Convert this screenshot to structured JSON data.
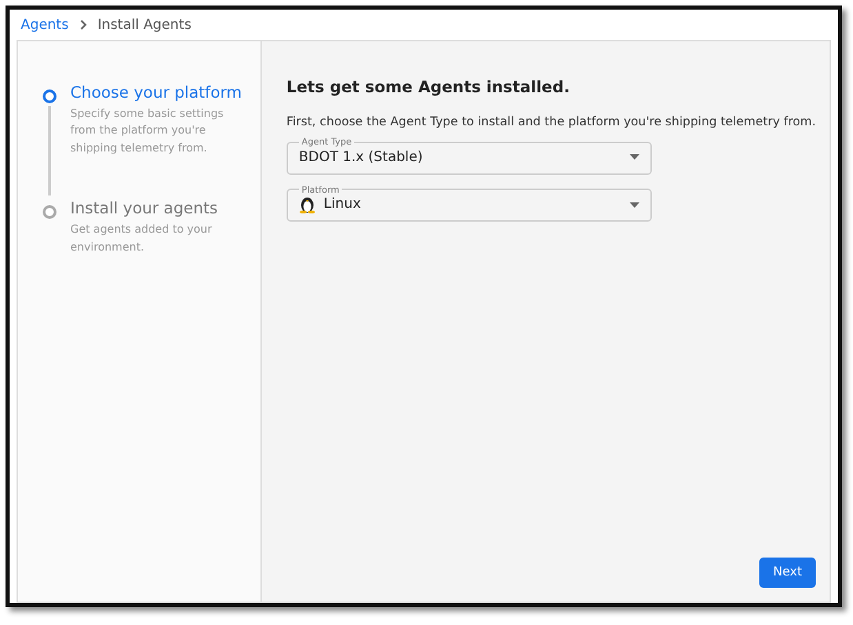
{
  "breadcrumb": [
    {
      "label": "Agents",
      "kind": "link"
    },
    {
      "label": "Install Agents",
      "kind": "current"
    }
  ],
  "steps": [
    {
      "title": "Choose your platform",
      "description": "Specify some basic settings from the platform you're shipping telemetry from.",
      "selected": true
    },
    {
      "title": "Install your agents",
      "description": "Get agents added to your environment.",
      "selected": false
    }
  ],
  "heading": "Lets get some Agents installed.",
  "intro": "First, choose the Agent Type to install and the platform you're shipping telemetry from.",
  "fields": [
    {
      "label": "Agent Type",
      "value": "BDOT 1.x (Stable)",
      "kind": "plain"
    },
    {
      "label": "Platform",
      "value": "Linux",
      "kind": "linux"
    }
  ],
  "next_button": "Next"
}
